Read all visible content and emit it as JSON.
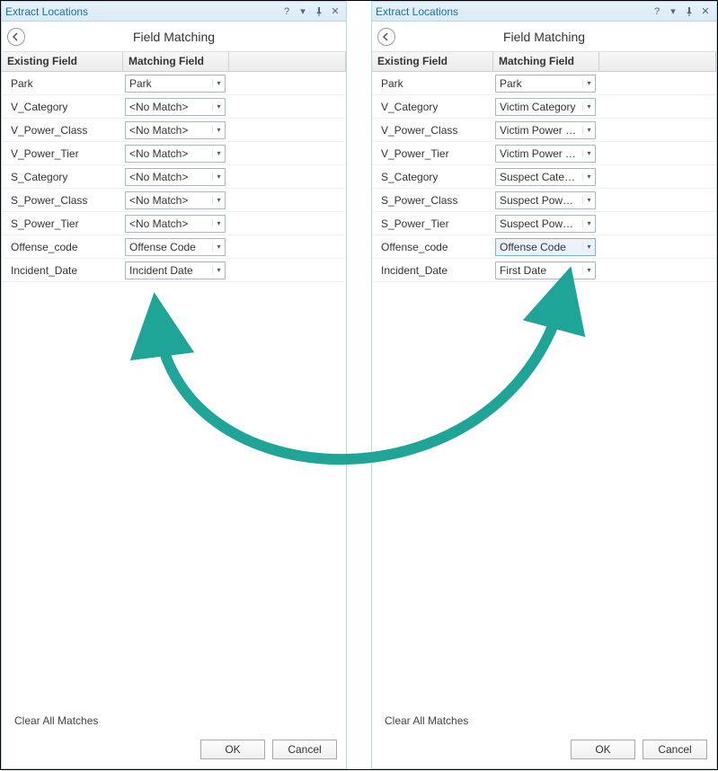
{
  "panels": [
    {
      "id": "left",
      "title": "Extract Locations",
      "sub_title": "Field Matching",
      "col_existing": "Existing Field",
      "col_matching": "Matching Field",
      "rows": [
        {
          "field": "Park",
          "match": "Park"
        },
        {
          "field": "V_Category",
          "match": "<No Match>"
        },
        {
          "field": "V_Power_Class",
          "match": "<No Match>"
        },
        {
          "field": "V_Power_Tier",
          "match": "<No Match>"
        },
        {
          "field": "S_Category",
          "match": "<No Match>"
        },
        {
          "field": "S_Power_Class",
          "match": "<No Match>"
        },
        {
          "field": "S_Power_Tier",
          "match": "<No Match>"
        },
        {
          "field": "Offense_code",
          "match": "Offense Code"
        },
        {
          "field": "Incident_Date",
          "match": "Incident Date"
        }
      ],
      "clear_label": "Clear All Matches",
      "ok_label": "OK",
      "cancel_label": "Cancel"
    },
    {
      "id": "right",
      "title": "Extract Locations",
      "sub_title": "Field Matching",
      "col_existing": "Existing Field",
      "col_matching": "Matching Field",
      "rows": [
        {
          "field": "Park",
          "match": "Park"
        },
        {
          "field": "V_Category",
          "match": "Victim Category"
        },
        {
          "field": "V_Power_Class",
          "match": "Victim Power Class"
        },
        {
          "field": "V_Power_Tier",
          "match": "Victim Power Tier"
        },
        {
          "field": "S_Category",
          "match": "Suspect Category"
        },
        {
          "field": "S_Power_Class",
          "match": "Suspect Power Class"
        },
        {
          "field": "S_Power_Tier",
          "match": "Suspect Power Tier"
        },
        {
          "field": "Offense_code",
          "match": "Offense Code",
          "highlight": true
        },
        {
          "field": "Incident_Date",
          "match": "First Date"
        }
      ],
      "clear_label": "Clear All Matches",
      "ok_label": "OK",
      "cancel_label": "Cancel"
    }
  ],
  "arrow_color": "#1fa597"
}
